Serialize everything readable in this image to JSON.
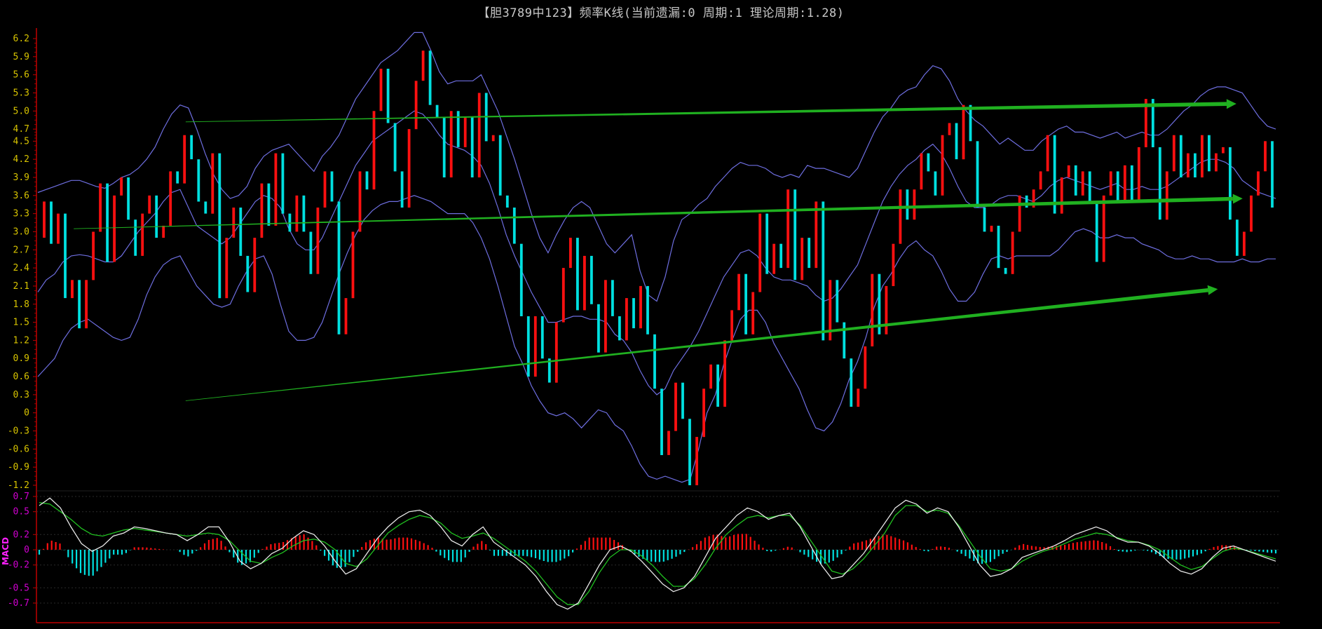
{
  "window": {
    "title": "【胆3789中123】频率K线(当前遗漏:0 周期:1 理论周期:1.28)"
  },
  "colors": {
    "background": "#000000",
    "axis": "#c00000",
    "up_candle": "#ff1010",
    "down_candle": "#00e0e0",
    "band": "#6e6ee0",
    "trend_arrow": "#20b020",
    "macd_dif": "#e8e8e8",
    "macd_dea": "#20c020",
    "macd_pos": "#ff1010",
    "macd_neg": "#00e0e0",
    "main_tick": "#d8c400",
    "macd_tick": "#d000d0"
  },
  "chart_data": [
    {
      "type": "candlestick",
      "title": "【胆3789中123】频率K线(当前遗漏:0 周期:1 理论周期:1.28)",
      "xlabel": "",
      "ylabel": "",
      "ylim": [
        -1.2,
        6.2
      ],
      "yticks": [
        "6.2",
        "5.9",
        "5.6",
        "5.3",
        "5.0",
        "4.7",
        "4.5",
        "4.2",
        "3.9",
        "3.6",
        "3.3",
        "3.0",
        "2.7",
        "2.4",
        "2.1",
        "1.8",
        "1.5",
        "1.2",
        "0.9",
        "0.6",
        "0.3",
        "0",
        "-0.3",
        "-0.6",
        "-0.9",
        "-1.2"
      ],
      "grid": false,
      "series": [
        {
          "kind": "close_path",
          "values": [
            2.9,
            3.5,
            2.8,
            3.3,
            1.9,
            2.2,
            1.4,
            2.2,
            3.0,
            3.8,
            2.5,
            3.6,
            3.9,
            3.2,
            2.6,
            3.3,
            3.6,
            2.9,
            3.1,
            4.0,
            3.8,
            4.6,
            4.2,
            3.5,
            3.3,
            4.3,
            1.9,
            2.9,
            3.4,
            2.6,
            2.0,
            2.9,
            3.8,
            3.1,
            4.3,
            3.3,
            3.0,
            3.6,
            3.0,
            2.3,
            3.4,
            4.0,
            3.5,
            1.3,
            1.9,
            3.0,
            4.0,
            3.7,
            5.0,
            5.7,
            4.8,
            4.0,
            3.4,
            4.7,
            5.5,
            6.0,
            5.1,
            4.9,
            3.9,
            5.0,
            4.4,
            4.9,
            3.9,
            5.3,
            4.5,
            4.6,
            3.6,
            3.4,
            2.8,
            1.6,
            0.6,
            1.6,
            0.9,
            0.5,
            1.5,
            2.4,
            2.9,
            1.7,
            2.6,
            1.8,
            1.0,
            2.2,
            1.6,
            1.2,
            1.9,
            1.4,
            2.1,
            1.3,
            0.4,
            -0.7,
            -0.3,
            0.5,
            -0.1,
            -1.2,
            -0.4,
            0.4,
            0.8,
            0.1,
            1.2,
            1.7,
            2.3,
            1.3,
            2.0,
            3.3,
            2.3,
            2.8,
            2.4,
            3.7,
            2.2,
            2.9,
            2.4,
            3.5,
            1.2,
            2.2,
            1.5,
            0.9,
            0.1,
            0.4,
            1.1,
            2.3,
            1.3,
            2.1,
            2.8,
            3.7,
            3.2,
            3.7,
            4.3,
            4.0,
            3.6,
            4.6,
            4.8,
            4.2,
            5.1,
            4.5,
            3.4,
            3.0,
            3.1,
            2.4,
            2.3,
            3.0,
            3.6,
            3.4,
            3.7,
            4.0,
            4.6,
            3.3,
            3.9,
            4.1,
            3.6,
            4.0,
            3.5,
            2.5,
            3.6,
            4.0,
            3.5,
            4.1,
            3.5,
            4.4,
            5.2,
            4.4,
            3.2,
            4.0,
            4.6,
            3.9,
            4.3,
            3.9,
            4.6,
            4.0,
            4.3,
            4.4,
            3.2,
            2.6,
            3.0,
            3.6,
            4.0,
            4.5,
            3.4
          ]
        },
        {
          "kind": "bollinger_upper",
          "values": [
            3.65,
            3.7,
            3.75,
            3.8,
            3.85,
            3.85,
            3.8,
            3.75,
            3.72,
            3.8,
            3.9,
            3.95,
            4.05,
            4.2,
            4.4,
            4.7,
            4.95,
            5.1,
            5.05,
            4.7,
            4.3,
            3.95,
            3.7,
            3.55,
            3.6,
            3.75,
            4.05,
            4.25,
            4.35,
            4.4,
            4.45,
            4.3,
            4.15,
            4.0,
            4.25,
            4.4,
            4.6,
            4.9,
            5.2,
            5.4,
            5.6,
            5.8,
            5.9,
            6.0,
            6.15,
            6.3,
            6.3,
            6.0,
            5.65,
            5.45,
            5.5,
            5.5,
            5.5,
            5.6,
            5.3,
            5.0,
            4.6,
            4.2,
            3.75,
            3.3,
            2.9,
            2.65,
            2.95,
            3.2,
            3.4,
            3.5,
            3.4,
            3.1,
            2.8,
            2.65,
            2.8,
            2.95,
            2.35,
            1.95,
            1.85,
            2.25,
            2.85,
            3.2,
            3.3,
            3.45,
            3.55,
            3.75,
            3.9,
            4.05,
            4.15,
            4.1,
            4.1,
            4.05,
            3.95,
            3.9,
            3.95,
            3.9,
            4.1,
            4.05,
            4.05,
            4.0,
            3.95,
            3.9,
            4.05,
            4.35,
            4.65,
            4.9,
            5.05,
            5.25,
            5.35,
            5.4,
            5.6,
            5.75,
            5.7,
            5.5,
            5.2,
            5.0,
            4.85,
            4.75,
            4.6,
            4.45,
            4.55,
            4.45,
            4.35,
            4.35,
            4.5,
            4.6,
            4.7,
            4.75,
            4.65,
            4.65,
            4.6,
            4.55,
            4.6,
            4.65,
            4.55,
            4.6,
            4.65,
            4.6,
            4.6,
            4.7,
            4.85,
            5.0,
            5.1,
            5.25,
            5.35,
            5.4,
            5.4,
            5.35,
            5.3,
            5.1,
            4.9,
            4.75,
            4.7
          ]
        },
        {
          "kind": "bollinger_lower",
          "values": [
            0.6,
            0.75,
            0.9,
            1.2,
            1.4,
            1.5,
            1.55,
            1.45,
            1.35,
            1.25,
            1.2,
            1.25,
            1.55,
            1.95,
            2.25,
            2.45,
            2.55,
            2.6,
            2.35,
            2.1,
            1.95,
            1.8,
            1.75,
            1.8,
            2.1,
            2.35,
            2.55,
            2.6,
            2.3,
            1.8,
            1.35,
            1.2,
            1.2,
            1.25,
            1.5,
            1.9,
            2.3,
            2.65,
            2.95,
            3.2,
            3.35,
            3.45,
            3.5,
            3.5,
            3.55,
            3.6,
            3.55,
            3.5,
            3.4,
            3.3,
            3.3,
            3.3,
            3.15,
            2.9,
            2.55,
            2.1,
            1.6,
            1.1,
            0.8,
            0.45,
            0.2,
            0.0,
            -0.05,
            0.0,
            -0.1,
            -0.25,
            -0.1,
            0.05,
            0.0,
            -0.2,
            -0.3,
            -0.55,
            -0.85,
            -1.05,
            -1.1,
            -1.05,
            -1.1,
            -1.15,
            -1.1,
            -0.6,
            0.0,
            0.3,
            0.8,
            1.2,
            1.55,
            1.7,
            1.7,
            1.5,
            1.15,
            0.9,
            0.65,
            0.4,
            0.05,
            -0.25,
            -0.3,
            -0.15,
            0.15,
            0.55,
            0.85,
            1.25,
            1.75,
            2.1,
            2.3,
            2.55,
            2.75,
            2.85,
            2.7,
            2.6,
            2.35,
            2.05,
            1.85,
            1.85,
            2.0,
            2.3,
            2.55,
            2.6,
            2.55,
            2.6,
            2.6,
            2.6,
            2.6,
            2.6,
            2.7,
            2.85,
            3.0,
            3.05,
            3.0,
            2.9,
            2.9,
            2.95,
            2.9,
            2.9,
            2.8,
            2.75,
            2.7,
            2.6,
            2.55,
            2.55,
            2.6,
            2.55,
            2.55,
            2.5,
            2.5,
            2.5,
            2.55,
            2.5,
            2.5,
            2.55,
            2.55
          ]
        },
        {
          "kind": "bollinger_mid",
          "values": [
            2.0,
            2.2,
            2.3,
            2.5,
            2.6,
            2.62,
            2.6,
            2.55,
            2.5,
            2.5,
            2.6,
            2.8,
            3.0,
            3.15,
            3.3,
            3.5,
            3.65,
            3.7,
            3.4,
            3.1,
            3.0,
            2.9,
            2.8,
            2.9,
            3.1,
            3.3,
            3.5,
            3.6,
            3.55,
            3.4,
            3.05,
            2.8,
            2.7,
            2.7,
            2.9,
            3.2,
            3.5,
            3.8,
            4.1,
            4.3,
            4.5,
            4.6,
            4.7,
            4.8,
            4.9,
            5.0,
            4.95,
            4.8,
            4.6,
            4.45,
            4.4,
            4.35,
            4.25,
            4.1,
            3.8,
            3.4,
            2.95,
            2.6,
            2.3,
            2.0,
            1.75,
            1.5,
            1.5,
            1.55,
            1.6,
            1.6,
            1.55,
            1.55,
            1.5,
            1.3,
            1.2,
            1.0,
            0.7,
            0.45,
            0.3,
            0.4,
            0.7,
            0.9,
            1.1,
            1.35,
            1.65,
            1.95,
            2.25,
            2.45,
            2.65,
            2.7,
            2.6,
            2.4,
            2.25,
            2.2,
            2.2,
            2.15,
            2.1,
            1.95,
            1.85,
            1.9,
            2.05,
            2.25,
            2.45,
            2.8,
            3.15,
            3.5,
            3.75,
            3.95,
            4.1,
            4.2,
            4.35,
            4.45,
            4.3,
            4.05,
            3.75,
            3.5,
            3.4,
            3.4,
            3.45,
            3.55,
            3.6,
            3.6,
            3.55,
            3.5,
            3.6,
            3.75,
            3.85,
            3.9,
            3.85,
            3.8,
            3.75,
            3.7,
            3.75,
            3.8,
            3.7,
            3.7,
            3.75,
            3.7,
            3.7,
            3.75,
            3.85,
            3.95,
            4.05,
            4.15,
            4.2,
            4.2,
            4.15,
            4.05,
            3.85,
            3.75,
            3.65,
            3.6,
            3.55
          ]
        }
      ],
      "annotations": [
        {
          "kind": "trend_arrow",
          "from": [
            0.12,
            4.82
          ],
          "to": [
            0.965,
            5.12
          ]
        },
        {
          "kind": "trend_arrow",
          "from": [
            0.03,
            3.05
          ],
          "to": [
            0.97,
            3.55
          ]
        },
        {
          "kind": "trend_arrow",
          "from": [
            0.12,
            0.2
          ],
          "to": [
            0.95,
            2.05
          ]
        }
      ]
    },
    {
      "type": "macd",
      "title": "MACD",
      "ylim": [
        -0.7,
        0.7
      ],
      "yticks": [
        "0.7",
        "0.5",
        "0.2",
        "0",
        "-0.2",
        "-0.5",
        "-0.7"
      ],
      "series": [
        {
          "name": "DIF",
          "values": [
            0.58,
            0.68,
            0.55,
            0.3,
            0.08,
            -0.02,
            0.05,
            0.18,
            0.22,
            0.3,
            0.28,
            0.25,
            0.22,
            0.2,
            0.12,
            0.2,
            0.3,
            0.3,
            0.1,
            -0.15,
            -0.25,
            -0.18,
            -0.05,
            0.02,
            0.15,
            0.25,
            0.2,
            0.05,
            -0.15,
            -0.32,
            -0.25,
            -0.05,
            0.15,
            0.3,
            0.42,
            0.5,
            0.52,
            0.45,
            0.3,
            0.12,
            0.05,
            0.2,
            0.3,
            0.1,
            0.0,
            -0.1,
            -0.2,
            -0.35,
            -0.55,
            -0.72,
            -0.78,
            -0.7,
            -0.45,
            -0.2,
            0.0,
            0.05,
            -0.02,
            -0.15,
            -0.3,
            -0.45,
            -0.55,
            -0.5,
            -0.35,
            -0.1,
            0.15,
            0.3,
            0.45,
            0.55,
            0.5,
            0.4,
            0.45,
            0.48,
            0.3,
            0.05,
            -0.2,
            -0.38,
            -0.35,
            -0.2,
            -0.05,
            0.15,
            0.35,
            0.55,
            0.65,
            0.6,
            0.48,
            0.55,
            0.5,
            0.3,
            0.05,
            -0.2,
            -0.35,
            -0.32,
            -0.25,
            -0.1,
            -0.05,
            0.0,
            0.05,
            0.12,
            0.2,
            0.25,
            0.3,
            0.25,
            0.15,
            0.1,
            0.1,
            0.05,
            -0.05,
            -0.18,
            -0.28,
            -0.32,
            -0.25,
            -0.1,
            0.02,
            0.05,
            0.0,
            -0.05,
            -0.1,
            -0.15
          ]
        },
        {
          "name": "DEA",
          "values": [
            0.62,
            0.6,
            0.5,
            0.4,
            0.28,
            0.2,
            0.18,
            0.22,
            0.26,
            0.28,
            0.26,
            0.24,
            0.22,
            0.2,
            0.18,
            0.2,
            0.22,
            0.2,
            0.12,
            -0.02,
            -0.15,
            -0.18,
            -0.1,
            -0.04,
            0.05,
            0.12,
            0.14,
            0.1,
            0.0,
            -0.18,
            -0.22,
            -0.12,
            0.05,
            0.22,
            0.32,
            0.4,
            0.45,
            0.42,
            0.35,
            0.22,
            0.15,
            0.18,
            0.22,
            0.15,
            0.05,
            -0.05,
            -0.15,
            -0.28,
            -0.45,
            -0.62,
            -0.72,
            -0.72,
            -0.55,
            -0.3,
            -0.1,
            0.0,
            0.0,
            -0.08,
            -0.2,
            -0.35,
            -0.48,
            -0.48,
            -0.38,
            -0.2,
            0.02,
            0.2,
            0.32,
            0.42,
            0.45,
            0.42,
            0.45,
            0.45,
            0.32,
            0.12,
            -0.08,
            -0.28,
            -0.32,
            -0.25,
            -0.12,
            0.05,
            0.22,
            0.45,
            0.58,
            0.58,
            0.5,
            0.52,
            0.48,
            0.32,
            0.12,
            -0.08,
            -0.25,
            -0.28,
            -0.25,
            -0.15,
            -0.08,
            -0.02,
            0.02,
            0.08,
            0.14,
            0.18,
            0.22,
            0.2,
            0.16,
            0.12,
            0.1,
            0.06,
            0.0,
            -0.1,
            -0.2,
            -0.26,
            -0.22,
            -0.12,
            -0.02,
            0.02,
            0.0,
            -0.04,
            -0.08,
            -0.12
          ]
        }
      ]
    }
  ]
}
